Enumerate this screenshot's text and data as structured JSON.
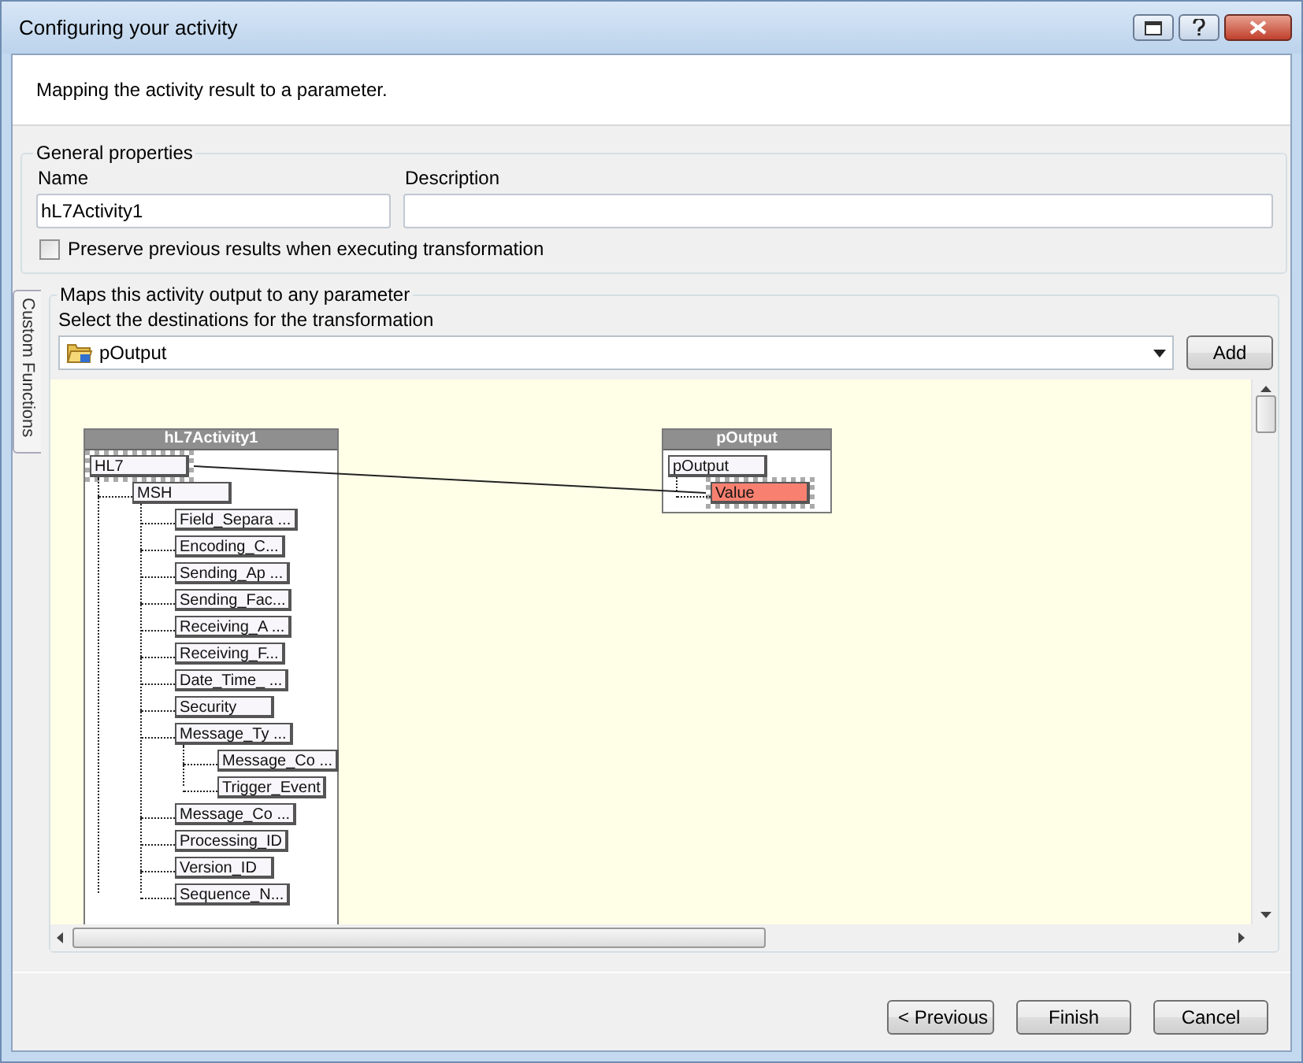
{
  "window": {
    "title": "Configuring your activity"
  },
  "header": {
    "description": "Mapping the activity result to a parameter."
  },
  "general_properties": {
    "title": "General properties",
    "name_label": "Name",
    "name_value": "hL7Activity1",
    "description_label": "Description",
    "preserve": {
      "label": "Preserve previous results when executing transformation",
      "checked": false
    }
  },
  "side_tab": {
    "label": "Custom Functions"
  },
  "mapping": {
    "title": "Maps this activity output to any parameter",
    "select_label": "Select the destinations for the transformation",
    "destination": "pOutput",
    "add_button": "Add",
    "source": {
      "title": "hL7Activity1",
      "nodes": [
        {
          "label": "HL7",
          "selected": true,
          "children": [
            {
              "label": "MSH",
              "selected": false,
              "children": [
                {
                  "label": "Field_Separa ...",
                  "selected": false
                },
                {
                  "label": "Encoding_C...",
                  "selected": false
                },
                {
                  "label": "Sending_Ap ...",
                  "selected": false
                },
                {
                  "label": "Sending_Fac...",
                  "selected": false
                },
                {
                  "label": "Receiving_A ...",
                  "selected": false
                },
                {
                  "label": "Receiving_F...",
                  "selected": false
                },
                {
                  "label": "Date_Time_ ...",
                  "selected": false
                },
                {
                  "label": "Security",
                  "selected": false
                },
                {
                  "label": "Message_Ty ...",
                  "selected": false,
                  "children": [
                    {
                      "label": "Message_Co ...",
                      "selected": false
                    },
                    {
                      "label": "Trigger_Event",
                      "selected": false
                    }
                  ]
                },
                {
                  "label": "Message_Co ...",
                  "selected": false
                },
                {
                  "label": "Processing_ID",
                  "selected": false
                },
                {
                  "label": "Version_ID",
                  "selected": false
                },
                {
                  "label": "Sequence_N...",
                  "selected": false
                }
              ]
            }
          ]
        }
      ]
    },
    "target": {
      "title": "pOutput",
      "nodes": [
        {
          "label": "pOutput",
          "selected": false,
          "children": [
            {
              "label": "Value",
              "selected": true
            }
          ]
        }
      ]
    }
  },
  "buttons": [
    {
      "label": "< Previous"
    },
    {
      "label": "Finish"
    },
    {
      "label": "Cancel"
    }
  ]
}
